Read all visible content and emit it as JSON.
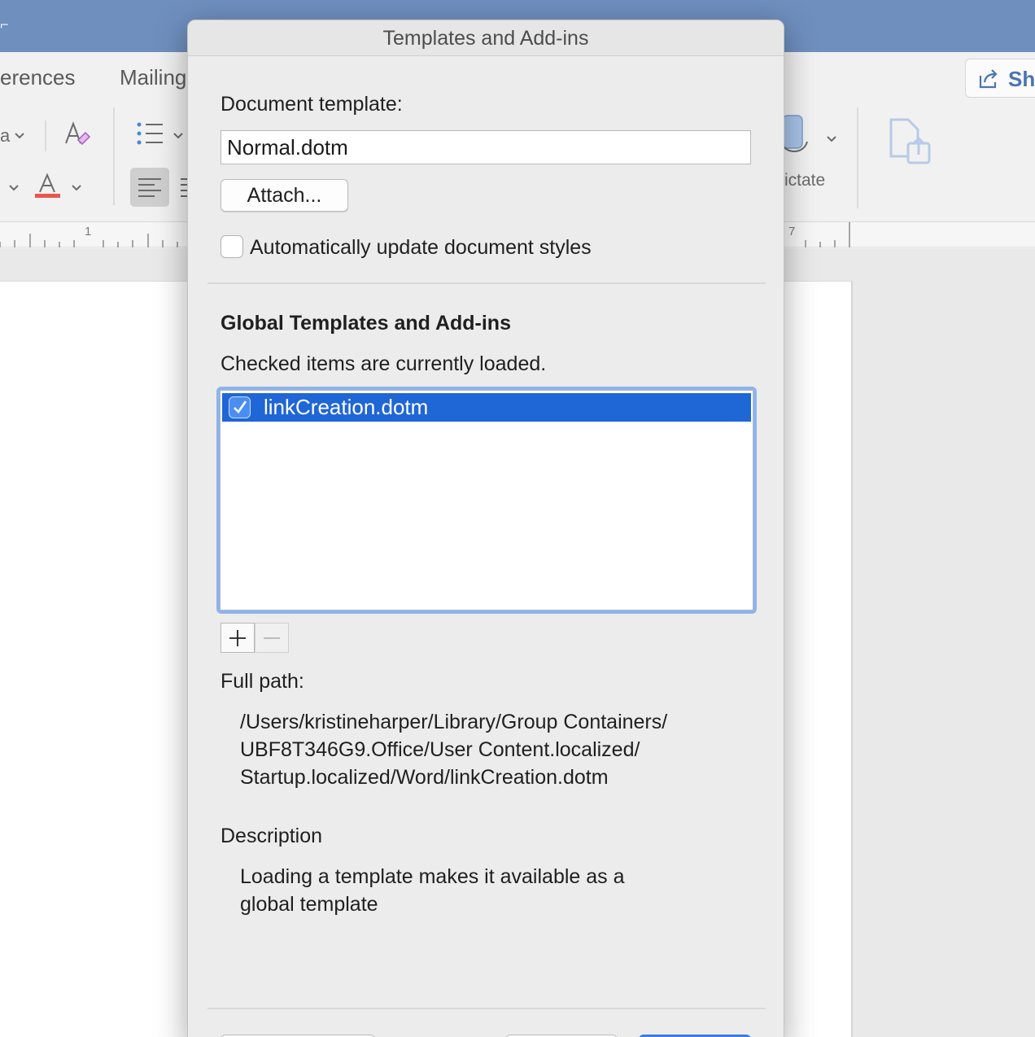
{
  "background_app": {
    "ribbon_tabs": [
      "erences",
      "Mailing"
    ],
    "share_label": "Sha",
    "dictate_label": "ictate",
    "ruler_numbers": [
      "1",
      "7"
    ],
    "colors": {
      "titlebar": "#6f8fbe",
      "font_color_bar": "#e8574f"
    }
  },
  "dialog": {
    "title": "Templates and Add-ins",
    "document_template_label": "Document template:",
    "document_template_value": "Normal.dotm",
    "attach_label": "Attach...",
    "auto_update_label": "Automatically update document styles",
    "auto_update_checked": false,
    "global_section_title": "Global Templates and Add-ins",
    "loaded_hint": "Checked items are currently loaded.",
    "items": [
      {
        "label": "linkCreation.dotm",
        "checked": true,
        "selected": true
      }
    ],
    "add_icon": "plus-icon",
    "remove_icon": "minus-icon",
    "full_path_label": "Full path:",
    "full_path_lines": [
      "/Users/kristineharper/Library/Group Containers/",
      "UBF8T346G9.Office/User Content.localized/",
      "Startup.localized/Word/linkCreation.dotm"
    ],
    "description_label": "Description",
    "description_lines": [
      "Loading a template makes it available as a",
      "global template"
    ],
    "colors": {
      "selection": "#1f66d6",
      "focus_ring": "#8fb3ea",
      "primary_button": "#3f7fe8"
    }
  }
}
